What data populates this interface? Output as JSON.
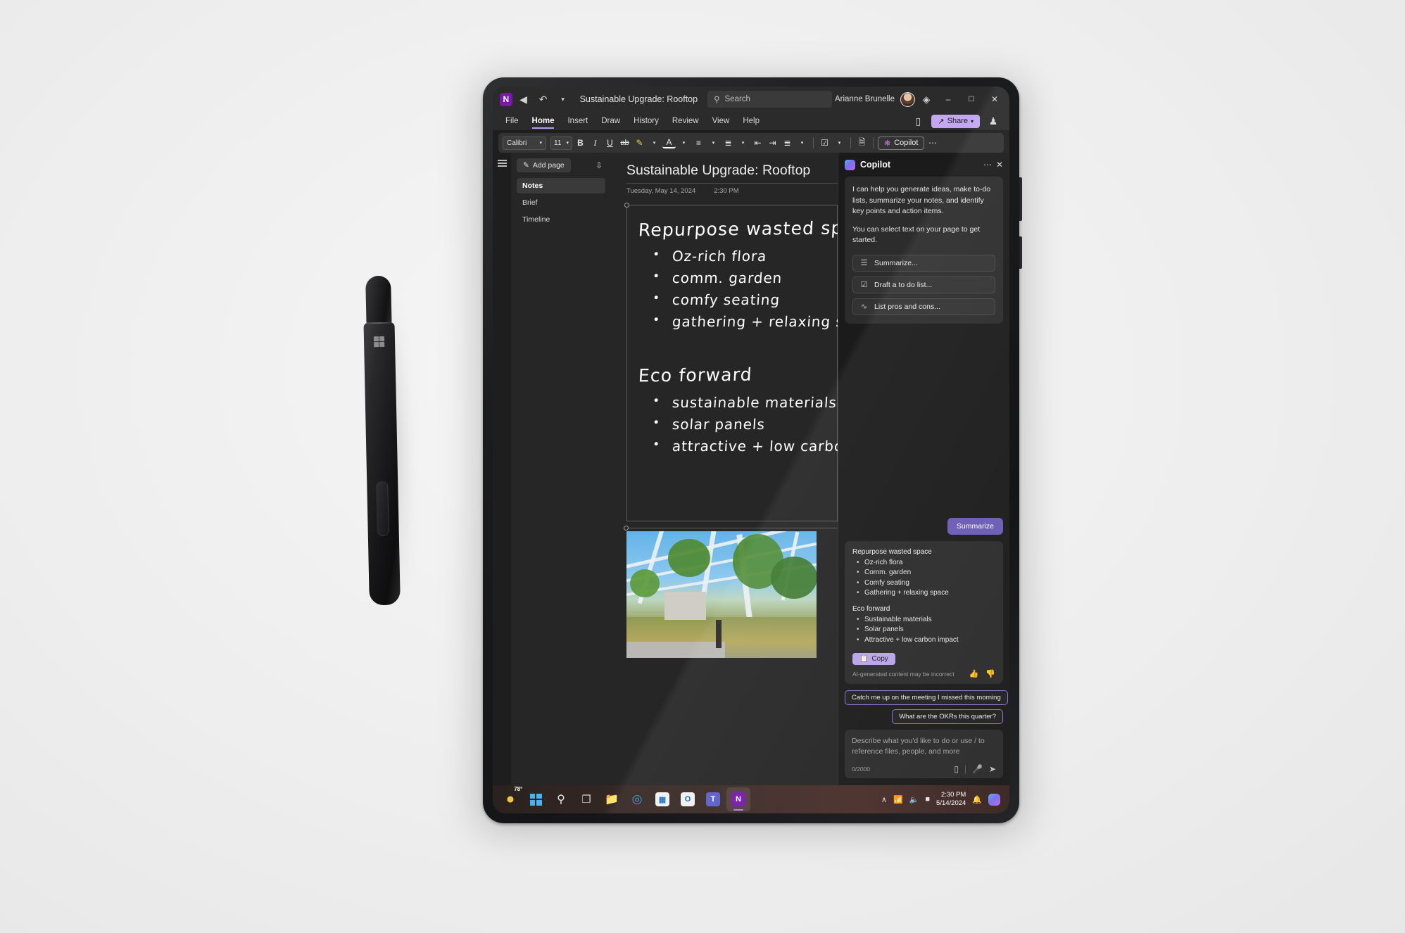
{
  "app": {
    "icon": "onenote-icon",
    "back_icon": "back-arrow-icon",
    "undo_icon": "undo-icon",
    "caret_icon": "caret-down-icon",
    "document_title": "Sustainable Upgrade: Rooftop",
    "account_name": "Arianne Brunelle",
    "premium_icon": "diamond-icon",
    "minimize": "–",
    "restore": "❐",
    "close": "✕"
  },
  "search": {
    "placeholder": "Search",
    "icon": "search-icon"
  },
  "ribbon": {
    "tabs": [
      "File",
      "Home",
      "Insert",
      "Draw",
      "History",
      "Review",
      "View",
      "Help"
    ],
    "active_tab": "Home",
    "sticky_notes_icon": "sticky-note-icon",
    "share_label": "Share",
    "share_caret": "⌄",
    "people_icon": "person-share-icon"
  },
  "toolbar": {
    "font_name": "Calibri",
    "font_size": "11",
    "bold": "B",
    "italic": "I",
    "underline": "U",
    "strikethrough": "ab",
    "highlight_icon": "highlighter-icon",
    "font_color_icon": "font-color-icon",
    "bullets_icon": "bullet-list-icon",
    "numbering_icon": "numbered-list-icon",
    "decrease_indent_icon": "decrease-indent-icon",
    "increase_indent_icon": "increase-indent-icon",
    "align_icon": "align-icon",
    "tags_icon": "tag-star-icon",
    "meeting_icon": "meeting-details-icon",
    "copilot_label": "Copilot",
    "copilot_icon": "copilot-icon",
    "more_icon": "more-options-icon",
    "collapse_icon": "collapse-ribbon-icon"
  },
  "navigation": {
    "hamburger_icon": "hamburger-menu-icon"
  },
  "pages": {
    "add_page_label": "Add page",
    "add_page_icon": "add-page-icon",
    "sort_icon": "sort-icon",
    "items": [
      {
        "label": "Notes",
        "active": true
      },
      {
        "label": "Brief",
        "active": false
      },
      {
        "label": "Timeline",
        "active": false
      }
    ]
  },
  "page": {
    "title": "Sustainable Upgrade: Rooftop",
    "date": "Tuesday, May 14, 2024",
    "time": "2:30 PM",
    "ink_sections": [
      {
        "heading": "Repurpose wasted space",
        "items": [
          "Oz-rich flora",
          "comm. garden",
          "comfy seating",
          "gathering + relaxing space"
        ]
      },
      {
        "heading": "Eco forward",
        "items": [
          "sustainable materials",
          "solar panels",
          "attractive + low carbon impact"
        ]
      }
    ],
    "photo_alt": "rooftop garden pergola photo"
  },
  "copilot": {
    "title": "Copilot",
    "logo_icon": "copilot-logo-icon",
    "more_icon": "more-options-icon",
    "close_icon": "close-icon",
    "intro_paragraph_1": "I can help you generate ideas, make to-do lists, summarize your notes, and identify key points and action items.",
    "intro_paragraph_2": "You can select text on your page to get started.",
    "actions": [
      {
        "label": "Summarize...",
        "icon": "lines-icon"
      },
      {
        "label": "Draft a to do list...",
        "icon": "checkbox-icon"
      },
      {
        "label": "List pros and cons...",
        "icon": "wave-icon"
      }
    ],
    "user_message": "Summarize",
    "response": {
      "sections": [
        {
          "heading": "Repurpose wasted space",
          "items": [
            "Oz-rich flora",
            "Comm. garden",
            "Comfy seating",
            "Gathering + relaxing space"
          ]
        },
        {
          "heading": "Eco forward",
          "items": [
            "Sustainable materials",
            "Solar panels",
            "Attractive + low carbon impact"
          ]
        }
      ],
      "copy_label": "Copy",
      "copy_icon": "copy-icon",
      "disclaimer": "AI-generated content may be incorrect",
      "thumbs_up_icon": "thumbs-up-icon",
      "thumbs_down_icon": "thumbs-down-icon"
    },
    "suggestions": [
      "Catch me up on the meeting I missed this morning",
      "What are the OKRs this quarter?"
    ],
    "input": {
      "placeholder": "Describe what you'd like to do or use / to reference files, people, and more",
      "char_count": "0/2000",
      "attach_icon": "attach-icon",
      "mic_icon": "microphone-icon",
      "send_icon": "send-icon"
    },
    "accent_color": "#6b5bb5",
    "chip_border_color": "#8f6fd6"
  },
  "taskbar": {
    "weather_temp": "78°",
    "items": [
      {
        "name": "weather",
        "label": "78°"
      },
      {
        "name": "start",
        "label": "Start"
      },
      {
        "name": "search",
        "label": "Search"
      },
      {
        "name": "task-view",
        "label": "Task View"
      },
      {
        "name": "file-explorer",
        "label": "File Explorer"
      },
      {
        "name": "edge",
        "label": "Microsoft Edge"
      },
      {
        "name": "store",
        "label": "Microsoft Store"
      },
      {
        "name": "outlook",
        "label": "Outlook"
      },
      {
        "name": "teams",
        "label": "Microsoft Teams"
      },
      {
        "name": "onenote",
        "label": "OneNote"
      }
    ],
    "tray": {
      "chevron": "∧",
      "network_icon": "network-icon",
      "volume_icon": "volume-icon",
      "battery_icon": "battery-icon",
      "time": "2:30 PM",
      "date": "5/14/2024",
      "notification_icon": "notification-bell-icon",
      "copilot_icon": "copilot-taskbar-icon"
    }
  },
  "device": {
    "pen_logo": "microsoft-logo",
    "pen_button": "pen-side-button"
  }
}
